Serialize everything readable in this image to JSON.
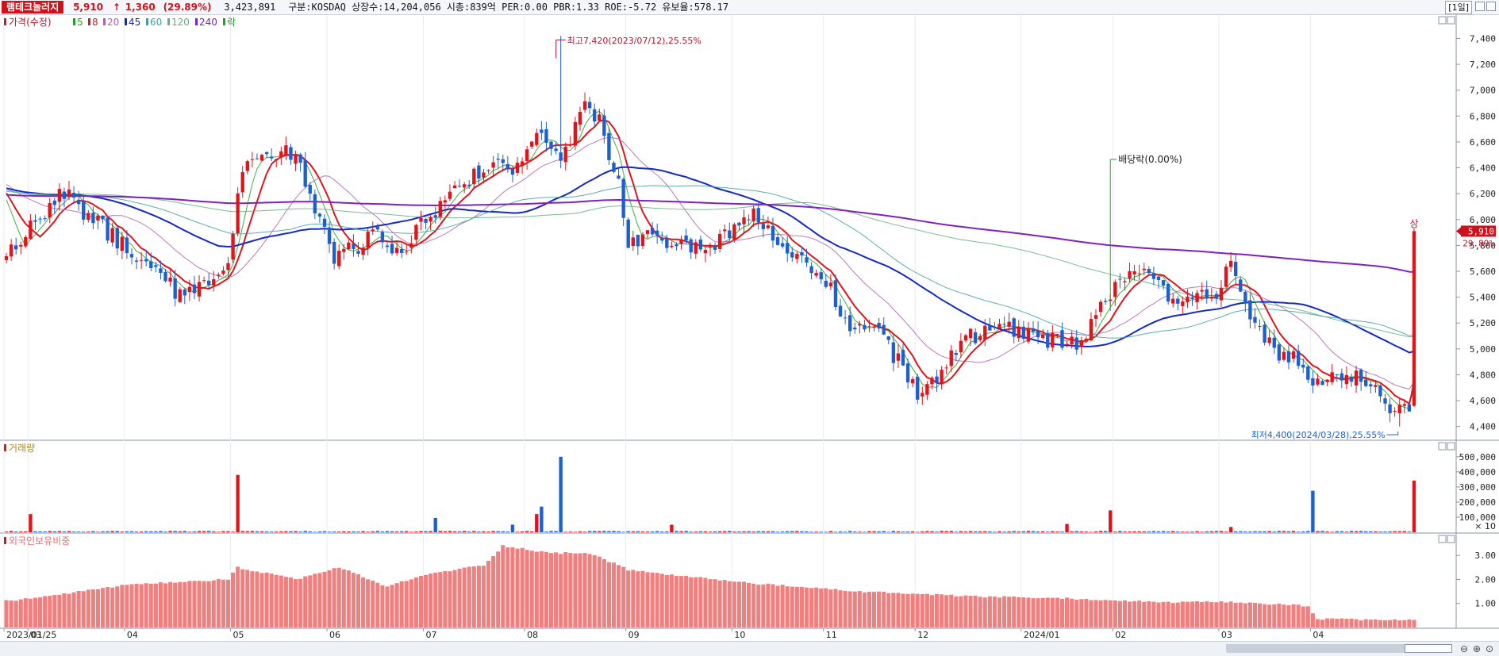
{
  "header": {
    "stock_name": "램테크놀러지",
    "price": "5,910",
    "arrow": "↑",
    "change": "1,360",
    "change_pct": "(29.89%)",
    "volume": "3,423,891",
    "info": "구분:KOSDAQ 상장수:14,204,056 시총:839억 PER:0.00 PBR:1.33 ROE:-5.72 유보율:578.17",
    "period": "[1일]"
  },
  "legend": {
    "price_label": "가격(수정)",
    "ma_labels": [
      "5",
      "8",
      "20",
      "45",
      "60",
      "120",
      "240"
    ],
    "ex_label": "락"
  },
  "colors": {
    "up": "#e0141b",
    "down": "#1e5fd0",
    "ma5": "#20a020",
    "ma8": "#e0141b",
    "ma20": "#b060b0",
    "ma45": "#1428c8",
    "ma60": "#40a0a0",
    "ma120": "#60b080",
    "ma240": "#8020c0",
    "foreign_bar": "#f08080"
  },
  "chart_data": [
    {
      "type": "candlestick",
      "title": "가격(수정)",
      "ylim": [
        4300,
        7550
      ],
      "y_ticks": [
        "7,400",
        "7,200",
        "7,000",
        "6,800",
        "6,600",
        "6,400",
        "6,200",
        "6,000",
        "5,800",
        "5,600",
        "5,400",
        "5,200",
        "5,000",
        "4,800",
        "4,600",
        "4,400"
      ],
      "x_ticks": [
        "2023/01/25",
        "03",
        "04",
        "05",
        "06",
        "07",
        "08",
        "09",
        "10",
        "11",
        "12",
        "2024/01",
        "02",
        "03",
        "04"
      ],
      "annotations": {
        "high": "최고7,420(2023/07/12),25.55%",
        "low": "최저4,400(2024/03/28),25.55%",
        "dividend": "배당락(0.00%)",
        "limit_up": "상",
        "last_price": "5,910",
        "last_pct": "29.89%"
      },
      "anchors": [
        [
          "2023-01-25",
          5700
        ],
        [
          "2023-02-01",
          5980
        ],
        [
          "2023-02-10",
          6200
        ],
        [
          "2023-02-20",
          6000
        ],
        [
          "2023-03-01",
          5800
        ],
        [
          "2023-03-10",
          5620
        ],
        [
          "2023-03-17",
          5400
        ],
        [
          "2023-03-24",
          5480
        ],
        [
          "2023-03-31",
          5650
        ],
        [
          "2023-04-05",
          6400
        ],
        [
          "2023-04-12",
          6550
        ],
        [
          "2023-04-20",
          6500
        ],
        [
          "2023-04-26",
          6100
        ],
        [
          "2023-05-03",
          5720
        ],
        [
          "2023-05-10",
          5780
        ],
        [
          "2023-05-17",
          5880
        ],
        [
          "2023-05-24",
          5740
        ],
        [
          "2023-05-31",
          5950
        ],
        [
          "2023-06-07",
          6100
        ],
        [
          "2023-06-14",
          6300
        ],
        [
          "2023-06-21",
          6400
        ],
        [
          "2023-06-28",
          6400
        ],
        [
          "2023-07-05",
          6650
        ],
        [
          "2023-07-12",
          6500
        ],
        [
          "2023-07-19",
          6850
        ],
        [
          "2023-07-24",
          6750
        ],
        [
          "2023-07-28",
          6250
        ],
        [
          "2023-08-01",
          5850
        ],
        [
          "2023-08-08",
          5870
        ],
        [
          "2023-08-14",
          5760
        ],
        [
          "2023-08-21",
          5800
        ],
        [
          "2023-08-28",
          5780
        ],
        [
          "2023-09-01",
          5950
        ],
        [
          "2023-09-07",
          6020
        ],
        [
          "2023-09-14",
          5800
        ],
        [
          "2023-09-21",
          5680
        ],
        [
          "2023-10-05",
          5450
        ],
        [
          "2023-10-12",
          5150
        ],
        [
          "2023-10-19",
          5200
        ],
        [
          "2023-10-26",
          4900
        ],
        [
          "2023-11-01",
          4650
        ],
        [
          "2023-11-08",
          4780
        ],
        [
          "2023-11-14",
          5100
        ],
        [
          "2023-11-21",
          5120
        ],
        [
          "2023-11-28",
          5150
        ],
        [
          "2023-12-05",
          5100
        ],
        [
          "2023-12-12",
          5050
        ],
        [
          "2023-12-18",
          5020
        ],
        [
          "2023-12-22",
          5260
        ],
        [
          "2023-12-28",
          5430
        ],
        [
          "2024-01-05",
          5550
        ],
        [
          "2024-01-10",
          5600
        ],
        [
          "2024-01-15",
          5470
        ],
        [
          "2024-01-19",
          5320
        ],
        [
          "2024-01-25",
          5400
        ],
        [
          "2024-01-31",
          5380
        ],
        [
          "2024-02-05",
          5700
        ],
        [
          "2024-02-07",
          5380
        ],
        [
          "2024-02-14",
          5180
        ],
        [
          "2024-02-21",
          4980
        ],
        [
          "2024-02-28",
          4880
        ],
        [
          "2024-03-04",
          4720
        ],
        [
          "2024-03-08",
          4750
        ],
        [
          "2024-03-15",
          4800
        ],
        [
          "2024-03-22",
          4640
        ],
        [
          "2024-03-28",
          4500
        ],
        [
          "2024-04-01",
          4550
        ]
      ],
      "last": {
        "date": "2024-04-02",
        "open": 4560,
        "high": 5910,
        "low": 4550,
        "close": 5910
      }
    },
    {
      "type": "bar",
      "title": "거래량",
      "ylim": [
        0,
        520000
      ],
      "y_ticks": [
        "500,000",
        "400,000",
        "300,000",
        "200,000",
        "100,000"
      ],
      "unit": "× 10",
      "spikes": [
        [
          "2023-02-01",
          120000
        ],
        [
          "2023-04-04",
          380000
        ],
        [
          "2023-06-06",
          95000
        ],
        [
          "2023-06-28",
          50000
        ],
        [
          "2023-07-05",
          120000
        ],
        [
          "2023-07-06",
          170000
        ],
        [
          "2023-07-12",
          500000
        ],
        [
          "2023-08-14",
          50000
        ],
        [
          "2023-12-14",
          55000
        ],
        [
          "2023-12-28",
          145000
        ],
        [
          "2024-02-05",
          35000
        ],
        [
          "2024-03-04",
          275000
        ],
        [
          "2024-04-02",
          342389
        ]
      ]
    },
    {
      "type": "bar",
      "title": "외국인보유비중",
      "ylim": [
        0,
        3.8
      ],
      "y_ticks": [
        "3.00",
        "2.00",
        "1.00"
      ],
      "anchors": [
        [
          "2023-01-25",
          1.1
        ],
        [
          "2023-02-10",
          1.4
        ],
        [
          "2023-03-01",
          1.75
        ],
        [
          "2023-03-31",
          2.0
        ],
        [
          "2023-04-04",
          2.5
        ],
        [
          "2023-04-20",
          2.0
        ],
        [
          "2023-05-05",
          2.5
        ],
        [
          "2023-05-20",
          1.7
        ],
        [
          "2023-06-01",
          2.2
        ],
        [
          "2023-06-20",
          2.6
        ],
        [
          "2023-06-26",
          3.4
        ],
        [
          "2023-07-10",
          3.1
        ],
        [
          "2023-07-20",
          3.1
        ],
        [
          "2023-08-01",
          2.4
        ],
        [
          "2023-08-20",
          2.1
        ],
        [
          "2023-09-10",
          1.8
        ],
        [
          "2023-10-15",
          1.5
        ],
        [
          "2023-11-15",
          1.3
        ],
        [
          "2023-12-15",
          1.2
        ],
        [
          "2024-01-15",
          1.05
        ],
        [
          "2024-02-05",
          1.05
        ],
        [
          "2024-03-01",
          0.9
        ],
        [
          "2024-03-05",
          0.35
        ],
        [
          "2024-04-02",
          0.3
        ]
      ]
    }
  ]
}
